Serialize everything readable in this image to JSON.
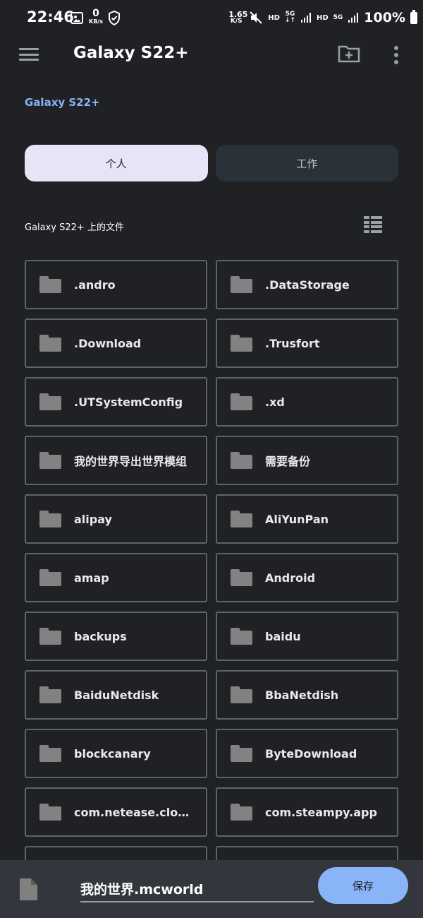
{
  "status_bar": {
    "time": "22:46",
    "left_netspeed_value": "0",
    "left_netspeed_unit": "KB/s",
    "right_netspeed_value": "1.65",
    "right_netspeed_unit": "K/S",
    "hd_1": "HD",
    "net_1": "5G",
    "hd_2": "HD",
    "net_2": "5G",
    "battery_percent": "100%"
  },
  "app_bar": {
    "title": "Galaxy S22+"
  },
  "breadcrumb": "Galaxy S22+",
  "tabs": [
    {
      "label": "个人",
      "selected": true
    },
    {
      "label": "工作",
      "selected": false
    }
  ],
  "section_label": "Galaxy S22+ 上的文件",
  "folders": [
    ".andro",
    ".DataStorage",
    ".Download",
    ".Trusfort",
    ".UTSystemConfig",
    ".xd",
    "我的世界导出世界模组",
    "需要备份",
    "alipay",
    "AliYunPan",
    "amap",
    "Android",
    "backups",
    "baidu",
    "BaiduNetdisk",
    "BbaNetdish",
    "blockcanary",
    "ByteDownload",
    "com.netease.cloud…",
    "com.steampy.app"
  ],
  "bottom_bar": {
    "filename": "我的世界.mcworld",
    "save_label": "保存"
  },
  "colors": {
    "background": "#202124",
    "accent": "#8ab4f8",
    "tab_active_bg": "#e8e4f8",
    "tab_inactive_bg": "#2b3138",
    "bottom_bar_bg": "#33373d"
  },
  "icons": {
    "menu": "menu-icon",
    "new_folder": "create-new-folder-icon",
    "more": "more-vert-icon",
    "view_toggle": "list-view-icon",
    "folder": "folder-icon",
    "file": "file-icon"
  }
}
